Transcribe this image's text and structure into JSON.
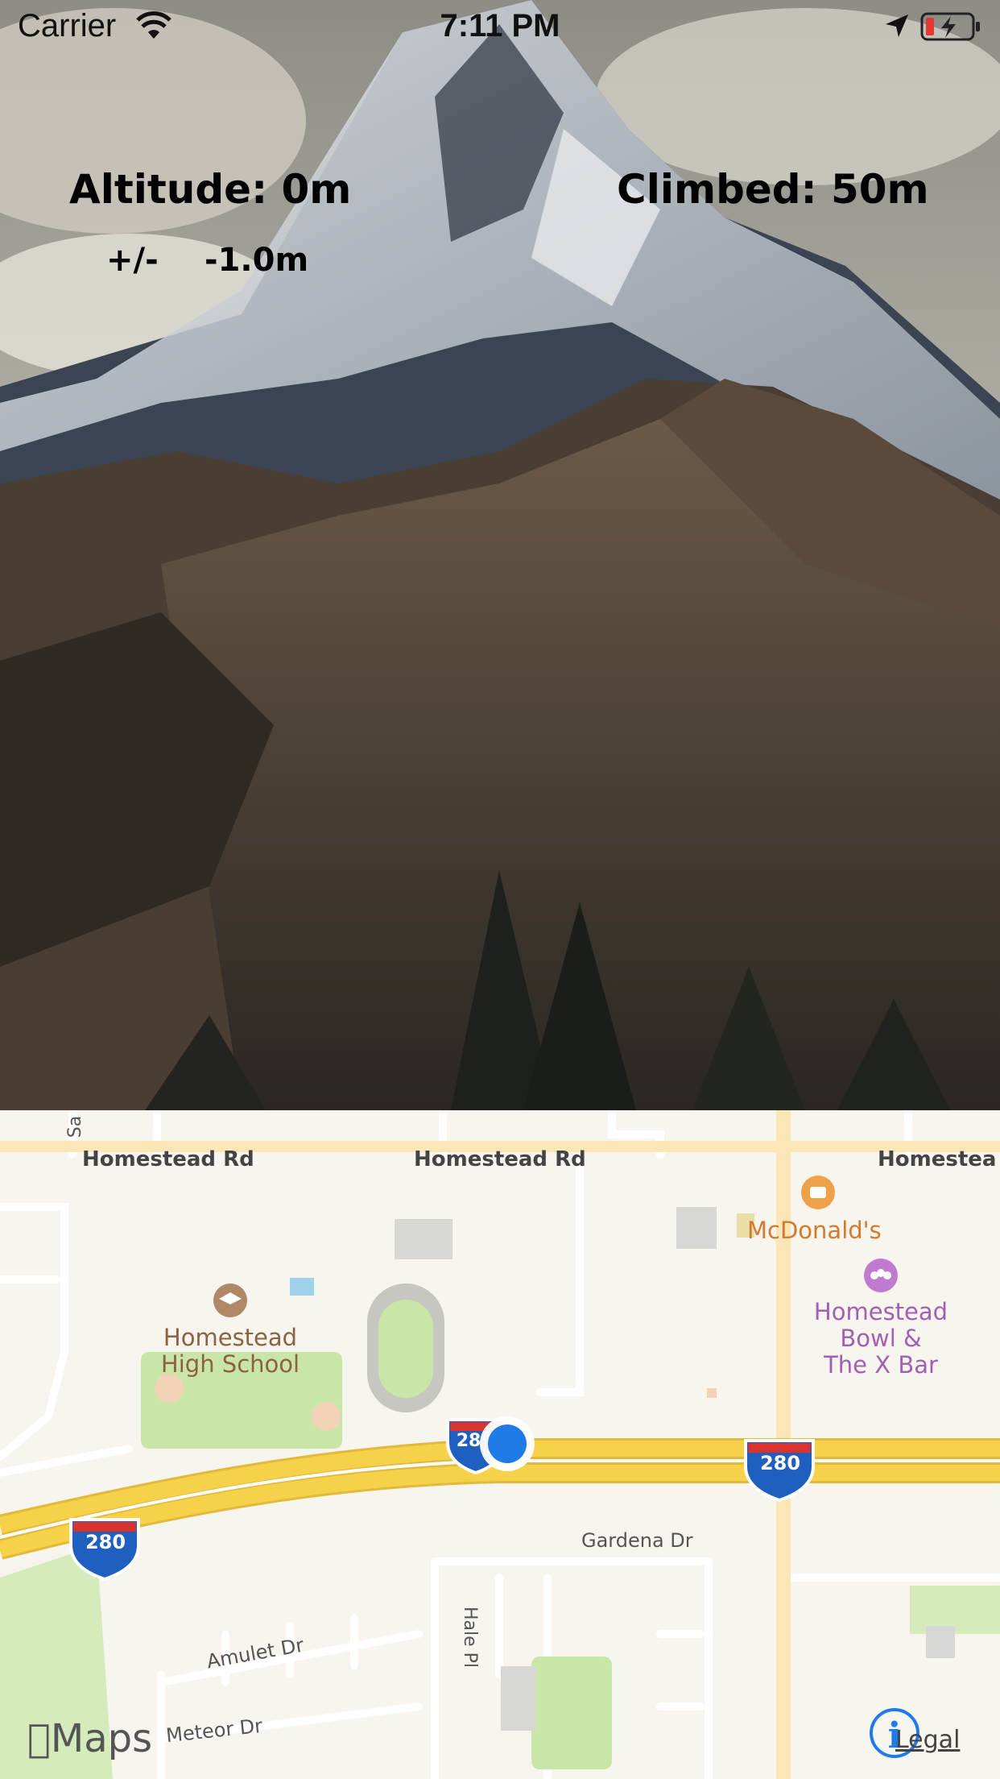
{
  "status_bar": {
    "carrier": "Carrier",
    "time": "7:11 PM",
    "battery_color": "#e53935"
  },
  "readouts": {
    "altitude": "Altitude: 0m",
    "climbed": "Climbed: 50m",
    "accuracy_label": "+/-",
    "accuracy_value": "-1.0m"
  },
  "map": {
    "roads": {
      "homestead_left": "Homestead Rd",
      "homestead_mid": "Homestead Rd",
      "homestead_right": "Homestea",
      "gardena": "Gardena Dr",
      "hale": "Hale Pl",
      "amulet": "Amulet Dr",
      "meteor": "Meteor Dr",
      "sa": "Sa"
    },
    "shields": {
      "i280_a": "280",
      "i280_b": "280",
      "i280_c": "28"
    },
    "pois": {
      "school": "Homestead\nHigh School",
      "mcdonalds": "McDonald's",
      "bowl": "Homestead\nBowl &\nThe X Bar"
    },
    "logo_text": "Maps",
    "legal_text": "Legal",
    "info_glyph": "i",
    "colors": {
      "highway": "#f5d24a",
      "park": "#c9e6a8",
      "user_dot": "#1e7be8"
    }
  }
}
